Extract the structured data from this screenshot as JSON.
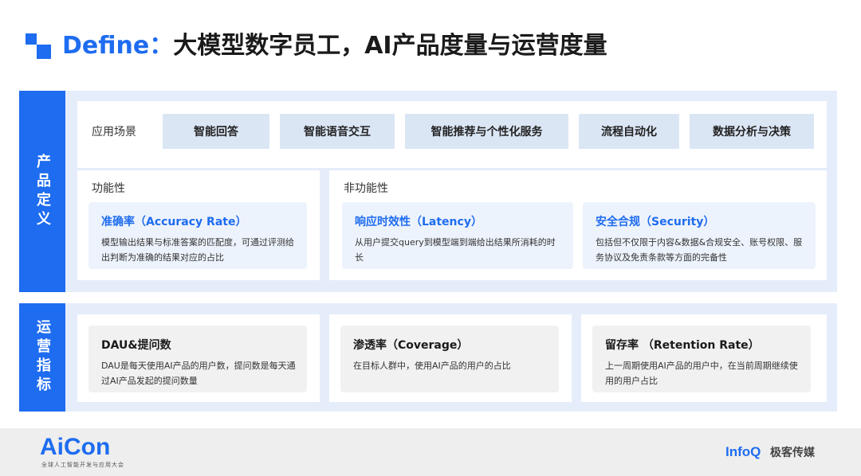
{
  "header": {
    "title_accent": "Define：",
    "title_rest": "大模型数字员工，AI产品度量与运营度量"
  },
  "product_section": {
    "label": "产品定义",
    "scenario": {
      "label": "应用场景",
      "chips": [
        "智能回答",
        "智能语音交互",
        "智能推荐与个性化服务",
        "流程自动化",
        "数据分析与决策"
      ]
    },
    "functional": {
      "title": "功能性",
      "cards": [
        {
          "title": "准确率（Accuracy Rate）",
          "desc": "模型输出结果与标准答案的匹配度，可通过评测给出判断为准确的结果对应的占比"
        }
      ]
    },
    "non_functional": {
      "title": "非功能性",
      "cards": [
        {
          "title": "响应时效性（Latency）",
          "desc": "从用户提交query到模型端到端给出结果所消耗的时长"
        },
        {
          "title": "安全合规（Security）",
          "desc": "包括但不仅限于内容&数据&合规安全、账号权限、服务协议及免责条款等方面的完备性"
        }
      ]
    }
  },
  "ops_section": {
    "label": "运营指标",
    "cards": [
      {
        "title": "DAU&提问数",
        "desc": "DAU是每天使用AI产品的用户数，提问数是每天通过AI产品发起的提问数量"
      },
      {
        "title": "渗透率（Coverage）",
        "desc": "在目标人群中，使用AI产品的用户的占比"
      },
      {
        "title": "留存率 （Retention Rate）",
        "desc": "上一周期使用AI产品的用户中，在当前周期继续使用的用户占比"
      }
    ]
  },
  "footer": {
    "aicon_logo": "AiCon",
    "aicon_subtitle": "全球人工智能开发与应用大会",
    "infoq": "InfoQ",
    "brand": "极客传媒"
  },
  "colors": {
    "accent": "#1e6cf0",
    "section_bg": "#e5edfb",
    "chip_bg": "#dbe6f5"
  }
}
